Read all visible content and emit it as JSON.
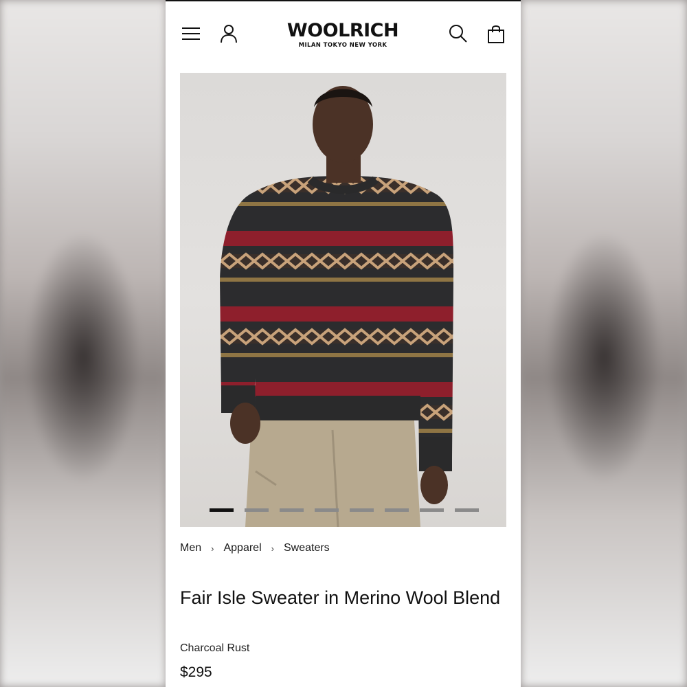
{
  "header": {
    "brand": "WOOLRICH",
    "brand_tagline": "MILAN  TOKYO  NEW YORK",
    "icons": [
      "menu-icon",
      "account-icon",
      "search-icon",
      "shopping-bag-icon"
    ]
  },
  "gallery": {
    "slide_count": 8,
    "active_index": 0
  },
  "breadcrumb": {
    "items": [
      "Men",
      "Apparel",
      "Sweaters"
    ],
    "separator": "›"
  },
  "product": {
    "title": "Fair Isle Sweater in Merino Wool Blend",
    "color": "Charcoal Rust",
    "price": "$295"
  },
  "colors": {
    "accent": "#111111",
    "dot_inactive": "#8a8a8a",
    "sweater_base": "#2c2c2e",
    "sweater_red": "#8e1f2c",
    "sweater_tan": "#c8a27a",
    "pants": "#b7a98f"
  }
}
